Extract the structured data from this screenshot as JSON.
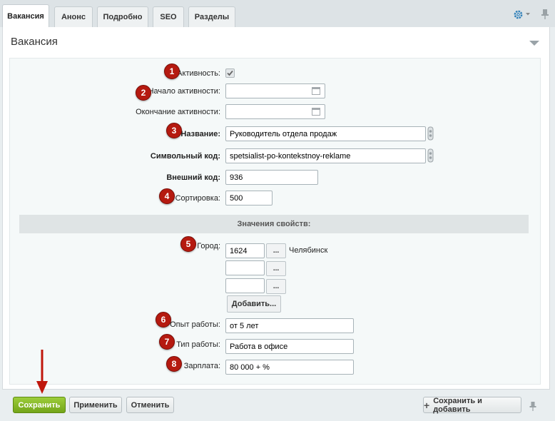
{
  "tabs": [
    {
      "label": "Вакансия",
      "active": true
    },
    {
      "label": "Анонс"
    },
    {
      "label": "Подробно"
    },
    {
      "label": "SEO"
    },
    {
      "label": "Разделы"
    }
  ],
  "panel": {
    "title": "Вакансия"
  },
  "form": {
    "active_label": "Активность:",
    "active_checked": true,
    "start_label": "Начало активности:",
    "start_value": "",
    "end_label": "Окончание активности:",
    "end_value": "",
    "name_label": "Название:",
    "name_value": "Руководитель отдела продаж",
    "code_label": "Символьный код:",
    "code_value": "spetsialist-po-kontekstnoy-reklame",
    "external_label": "Внешний код:",
    "external_value": "936",
    "sort_label": "Сортировка:",
    "sort_value": "500"
  },
  "properties": {
    "section_title": "Значения свойств:",
    "city_label": "Город:",
    "city_values": [
      "1624",
      "",
      ""
    ],
    "city_name": "Челябинск",
    "dots_label": "...",
    "add_label": "Добавить...",
    "experience_label": "Опыт работы:",
    "experience_value": "от 5 лет",
    "worktype_label": "Тип работы:",
    "worktype_value": "Работа в офисе",
    "salary_label": "Зарплата:",
    "salary_value": "80 000 + %"
  },
  "badges": [
    "1",
    "2",
    "3",
    "4",
    "5",
    "6",
    "7",
    "8"
  ],
  "footer": {
    "save": "Сохранить",
    "apply": "Применить",
    "cancel": "Отменить",
    "save_add": "Сохранить и добавить"
  },
  "colors": {
    "badge": "#b51a10",
    "save_button": "#8bbd2c",
    "arrow": "#c0170c"
  },
  "icons": [
    "gear-icon",
    "chevron-down-icon",
    "pin-icon",
    "calendar-icon",
    "lock-icon",
    "plus-icon",
    "arrow-icon"
  ]
}
